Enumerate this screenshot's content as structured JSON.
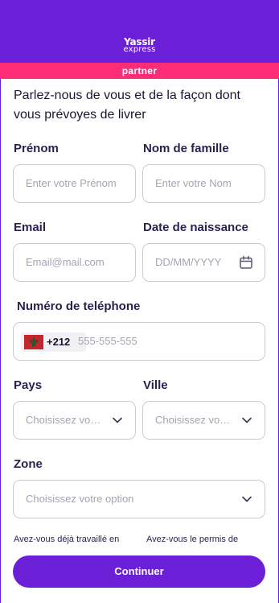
{
  "header": {
    "logo_main": "Yassir",
    "logo_sub": "express",
    "partner": "partner"
  },
  "intro": "Parlez-nous de vous et de la façon dont vous prévoyes de livrer",
  "form": {
    "first_name": {
      "label": "Prénom",
      "placeholder": "Enter votre Prénom"
    },
    "last_name": {
      "label": "Nom de famille",
      "placeholder": "Enter votre Nom"
    },
    "email": {
      "label": "Email",
      "placeholder": "Email@mail.com"
    },
    "birthdate": {
      "label": "Date de naissance",
      "placeholder": "DD/MM/YYYY",
      "icon": "calendar-icon"
    },
    "phone": {
      "label": "Numéro de teléphone",
      "dial_code": "+212",
      "flag": "morocco-flag",
      "placeholder": "555-555-555"
    },
    "country": {
      "label": "Pays",
      "placeholder": "Choisissez votre option",
      "icon": "chevron-down-icon"
    },
    "city": {
      "label": "Ville",
      "placeholder": "Choisissez votre option",
      "icon": "chevron-down-icon"
    },
    "zone": {
      "label": "Zone",
      "placeholder": "Choisissez votre option",
      "icon": "chevron-down-icon"
    },
    "question_left": "Avez-vous déjà travaillé en",
    "question_right": "Avez-vous le permis de"
  },
  "submit_label": "Continuer",
  "colors": {
    "brand": "#6b1fd6",
    "accent": "#ff2d78",
    "border": "#cdcad6",
    "placeholder": "#a6a3b3"
  }
}
